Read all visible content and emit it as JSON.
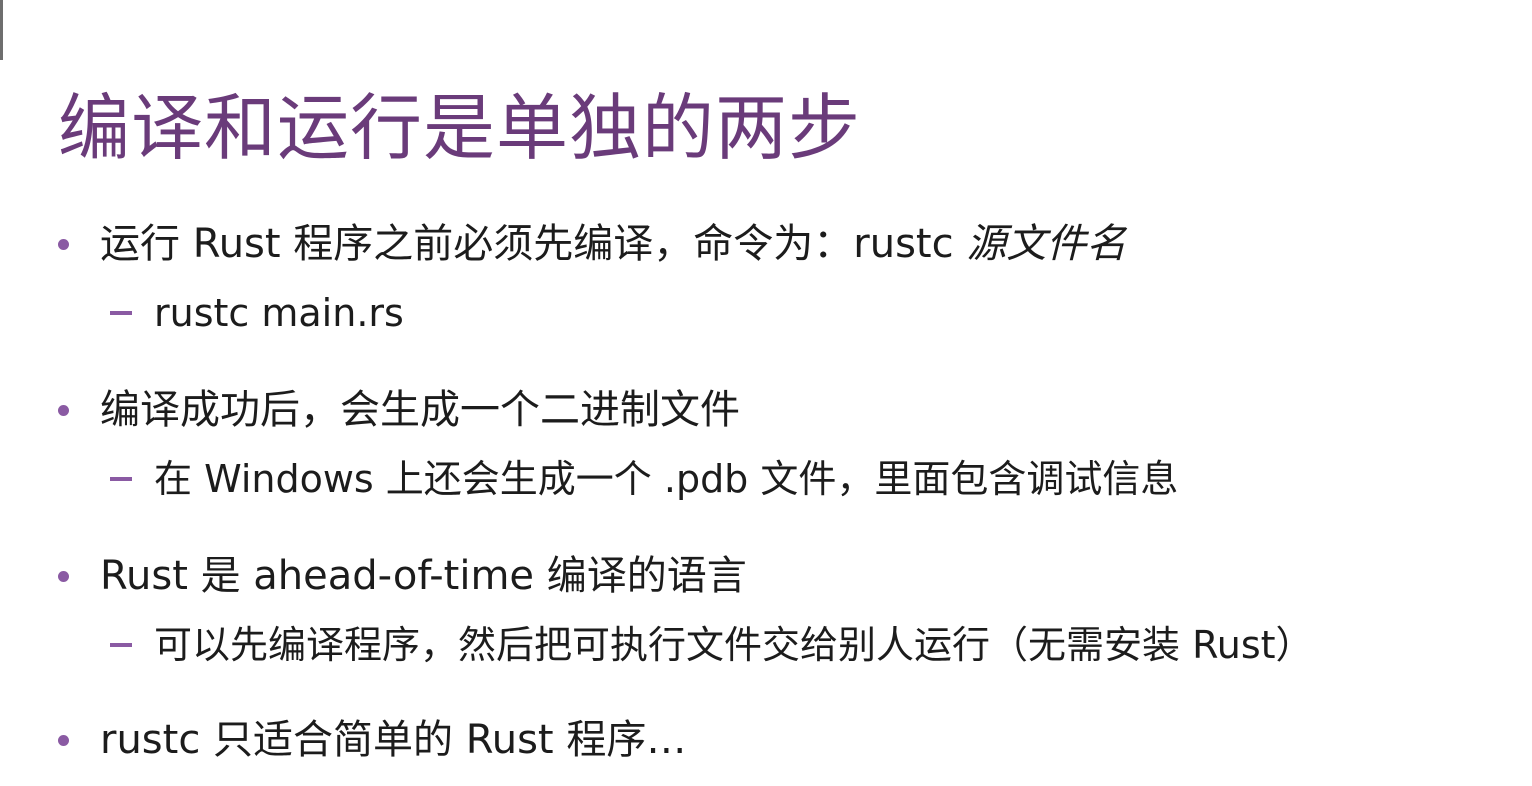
{
  "slide": {
    "title": "编译和运行是单独的两步",
    "bullets": [
      {
        "text": "运行 Rust 程序之前必须先编译，命令为：rustc ",
        "emphasis": "源文件名",
        "sub": "rustc main.rs"
      },
      {
        "text": "编译成功后，会生成一个二进制文件",
        "sub": "在 Windows 上还会生成一个 .pdb 文件，里面包含调试信息"
      },
      {
        "text": "Rust 是 ahead-of-time 编译的语言",
        "sub": "可以先编译程序，然后把可执行文件交给别人运行（无需安装 Rust）"
      },
      {
        "text": "rustc 只适合简单的 Rust 程序…"
      }
    ]
  },
  "colors": {
    "title": "#6a3b7a",
    "bullet_marker": "#8a5aa3",
    "body_text": "#1c1c1c",
    "background": "#ffffff"
  }
}
